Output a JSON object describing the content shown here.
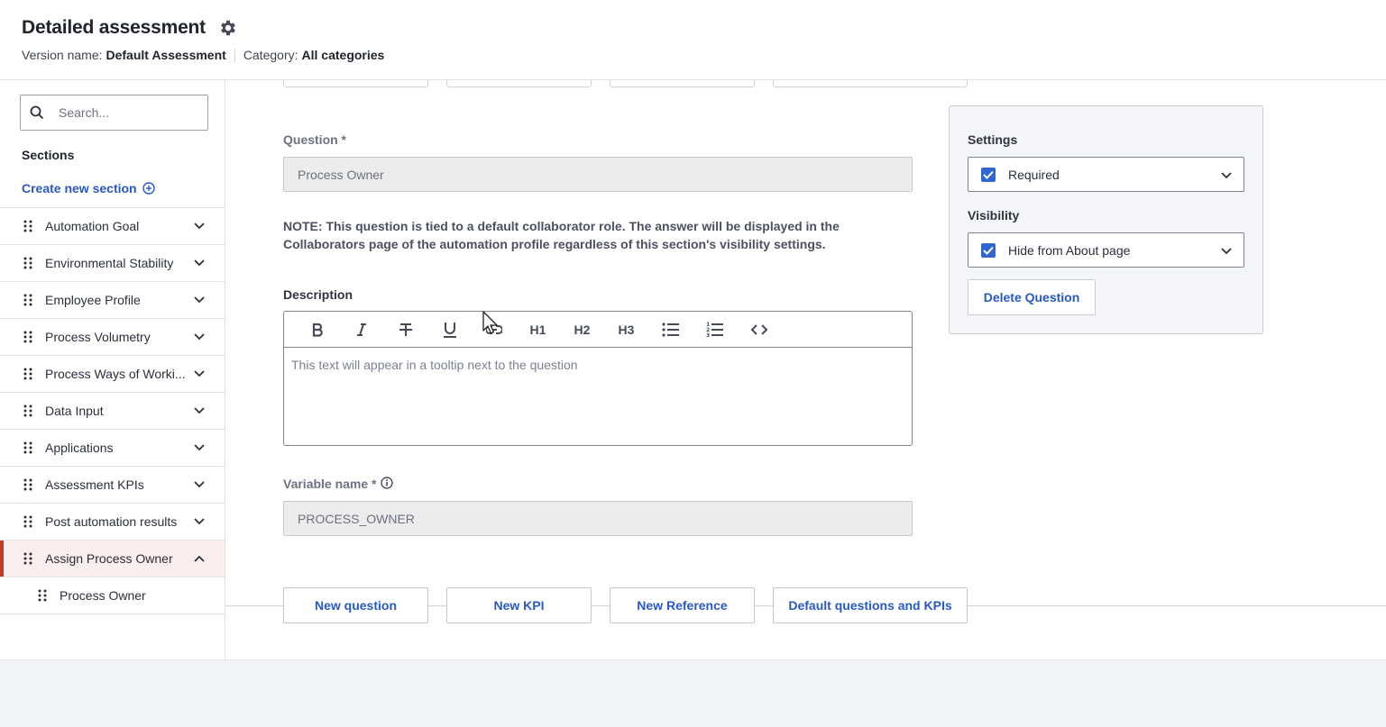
{
  "header": {
    "title": "Detailed assessment",
    "version_label": "Version name:",
    "version_value": "Default Assessment",
    "category_label": "Category:",
    "category_value": "All categories"
  },
  "sidebar": {
    "search_placeholder": "Search...",
    "sections_label": "Sections",
    "create_section_label": "Create new section",
    "items": [
      {
        "label": "Automation Goal",
        "expanded": false
      },
      {
        "label": "Environmental Stability",
        "expanded": false
      },
      {
        "label": "Employee Profile",
        "expanded": false
      },
      {
        "label": "Process Volumetry",
        "expanded": false
      },
      {
        "label": "Process Ways of Worki...",
        "expanded": false
      },
      {
        "label": "Data Input",
        "expanded": false
      },
      {
        "label": "Applications",
        "expanded": false
      },
      {
        "label": "Assessment KPIs",
        "expanded": false
      },
      {
        "label": "Post automation results",
        "expanded": false
      },
      {
        "label": "Assign Process Owner",
        "expanded": true,
        "active": true
      }
    ],
    "child_items": [
      {
        "label": "Process Owner"
      }
    ]
  },
  "main": {
    "question_label": "Question *",
    "question_value": "Process Owner",
    "note": "NOTE: This question is tied to a default collaborator role. The answer will be displayed in the Collaborators page of the automation profile regardless of this section's visibility settings.",
    "description_label": "Description",
    "description_placeholder": "This text will appear in a tooltip next to the question",
    "toolbar": {
      "bold": "B",
      "h1": "H1",
      "h2": "H2",
      "h3": "H3"
    },
    "variable_label": "Variable name *",
    "variable_value": "PROCESS_OWNER",
    "add_buttons": {
      "new_question": "New question",
      "new_kpi": "New KPI",
      "new_reference": "New Reference",
      "default_questions": "Default questions and KPIs"
    }
  },
  "settings": {
    "settings_label": "Settings",
    "required_label": "Required",
    "required_checked": true,
    "visibility_label": "Visibility",
    "hide_label": "Hide from About page",
    "hide_checked": true,
    "delete_label": "Delete Question"
  },
  "colors": {
    "accent": "#2859c5",
    "active_marker": "#c0392b",
    "active_bg": "#fbeeee",
    "checkbox": "#2f66d0"
  }
}
